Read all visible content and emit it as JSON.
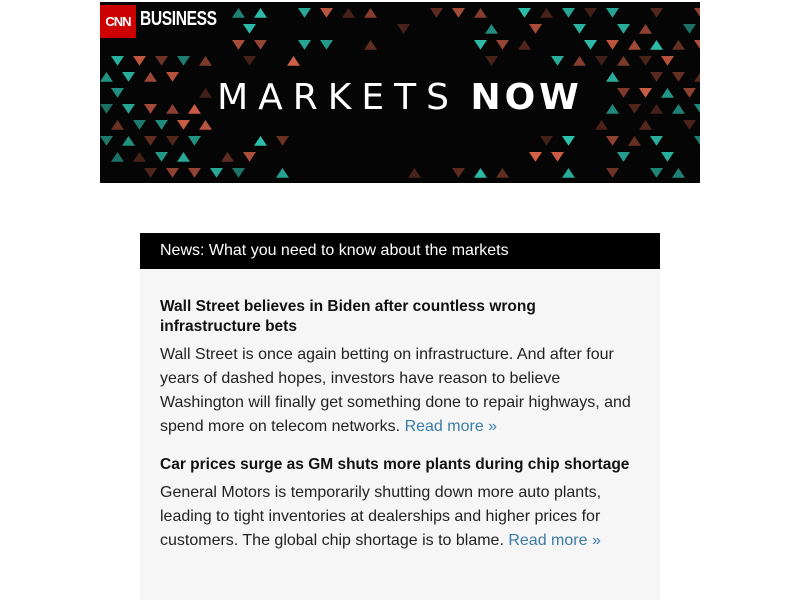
{
  "banner": {
    "logo": {
      "brand": "CNN",
      "label": "BUSINESS"
    },
    "title_light": "MARKETS",
    "title_bold": "NOW",
    "colors": {
      "background": "#050505",
      "teal": "#2ec4b0",
      "orange": "#d9634a",
      "brown": "#6e3326"
    }
  },
  "news": {
    "header": "News: What you need to know about the markets",
    "articles": [
      {
        "title": "Wall Street believes in Biden after countless wrong infrastructure bets",
        "body": "Wall Street is once again betting on infrastructure. And after four years of dashed hopes, investors have reason to believe Washington will finally get something done to repair highways, and spend more on telecom networks.",
        "link": "Read more »"
      },
      {
        "title": "Car prices surge as GM shuts more plants during chip shortage",
        "body": "General Motors is temporarily shutting down more auto plants, leading to tight inventories at dealerships and higher prices for customers. The global chip shortage is to blame.",
        "link": "Read more »"
      }
    ]
  }
}
